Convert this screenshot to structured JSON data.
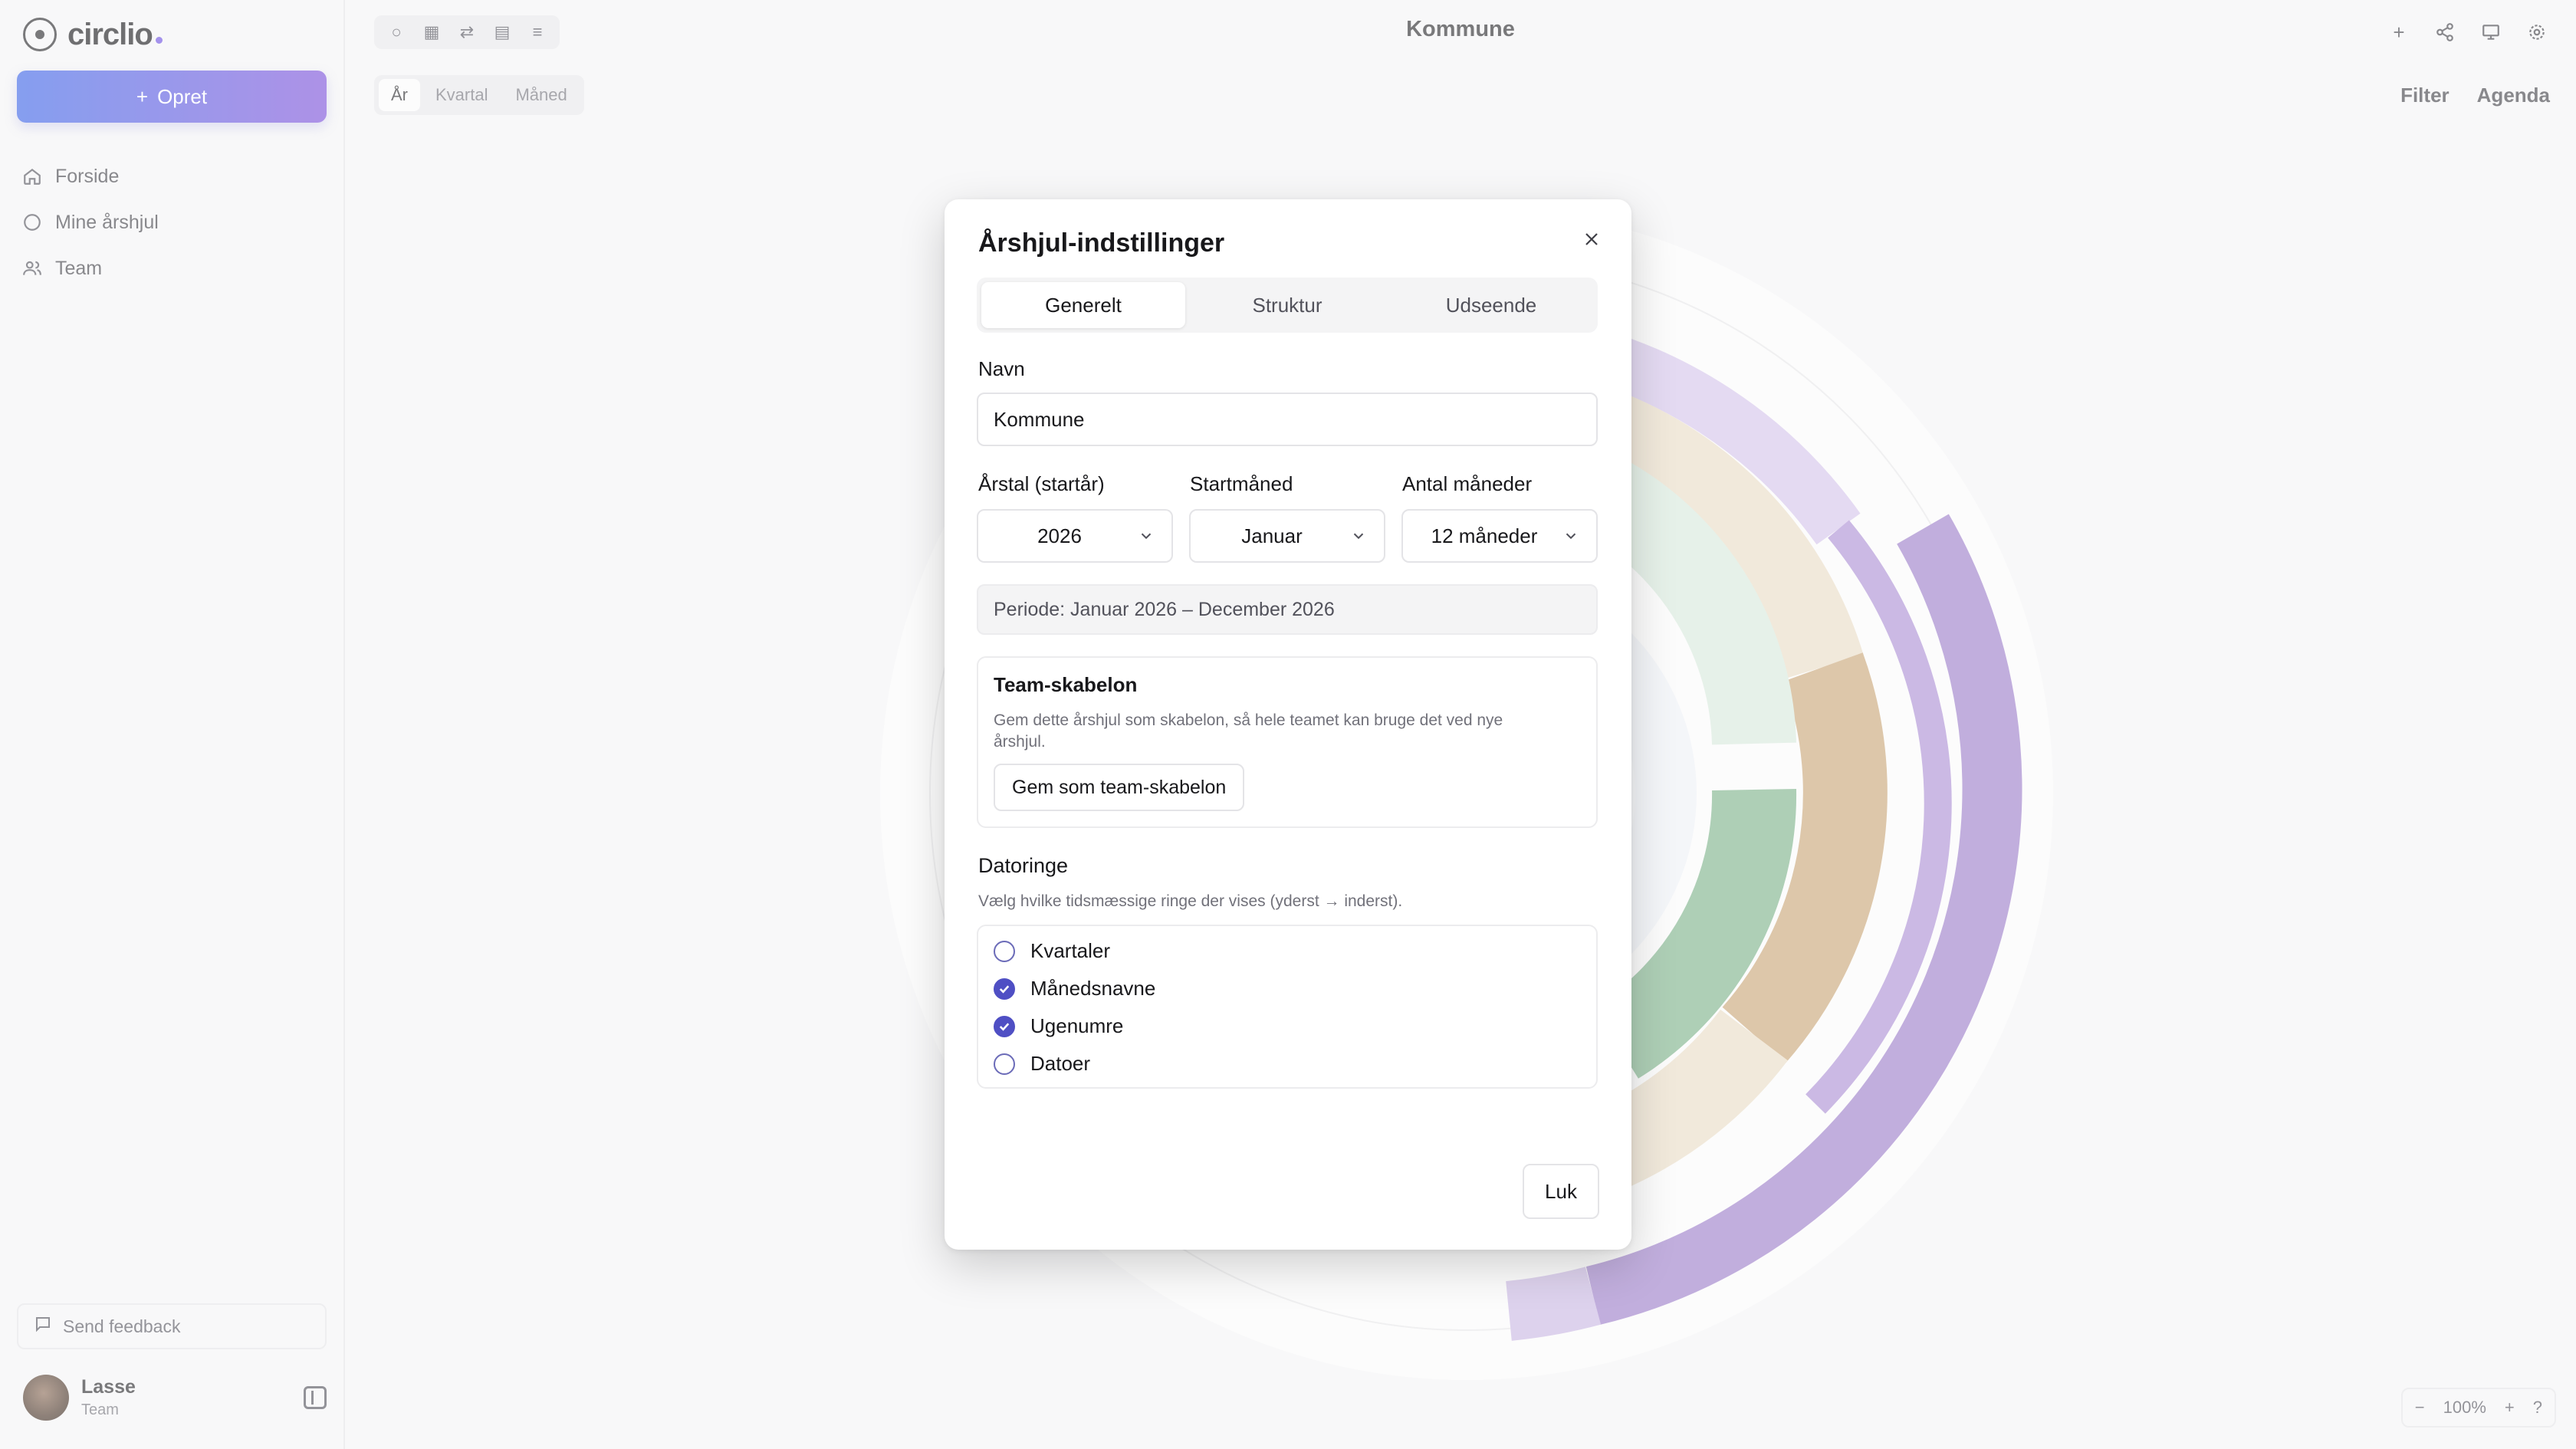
{
  "app": {
    "name": "circlio",
    "document_title": "Kommune"
  },
  "sidebar": {
    "create_label": "Opret",
    "items": [
      {
        "label": "Forside",
        "icon": "home-icon"
      },
      {
        "label": "Mine årshjul",
        "icon": "circle-icon"
      },
      {
        "label": "Team",
        "icon": "users-icon"
      }
    ],
    "feedback_label": "Send feedback",
    "user": {
      "name": "Lasse",
      "role": "Team"
    }
  },
  "toolbar": {
    "period_tabs": [
      "År",
      "Kvartal",
      "Måned"
    ],
    "active_period": "År",
    "filter_label": "Filter",
    "agenda_label": "Agenda"
  },
  "zoom": {
    "level": "100%"
  },
  "modal": {
    "title": "Årshjul-indstillinger",
    "tabs": [
      "Generelt",
      "Struktur",
      "Udseende"
    ],
    "active_tab": "Generelt",
    "name_label": "Navn",
    "name_value": "Kommune",
    "year_label": "Årstal (startår)",
    "year_value": "2026",
    "start_month_label": "Startmåned",
    "start_month_value": "Januar",
    "months_label": "Antal måneder",
    "months_value": "12 måneder",
    "period_text": "Periode: Januar 2026 – December 2026",
    "template": {
      "title": "Team-skabelon",
      "description": "Gem dette årshjul som skabelon, så hele teamet kan bruge det ved nye årshjul.",
      "button": "Gem som team-skabelon"
    },
    "date_rings": {
      "title": "Datoringe",
      "description": "Vælg hvilke tidsmæssige ringe der vises (yderst → inderst).",
      "options": [
        {
          "label": "Kvartaler",
          "checked": false
        },
        {
          "label": "Månedsnavne",
          "checked": true
        },
        {
          "label": "Ugenumre",
          "checked": true
        },
        {
          "label": "Datoer",
          "checked": false
        }
      ]
    },
    "close_label": "Luk"
  },
  "colors": {
    "accent": "#4f4fc4",
    "gradient_start": "#3b63e6",
    "gradient_end": "#7b4fd8",
    "ring_purple": "#9b7cc9",
    "ring_tan": "#c9a577",
    "ring_green": "#7cb28a"
  }
}
